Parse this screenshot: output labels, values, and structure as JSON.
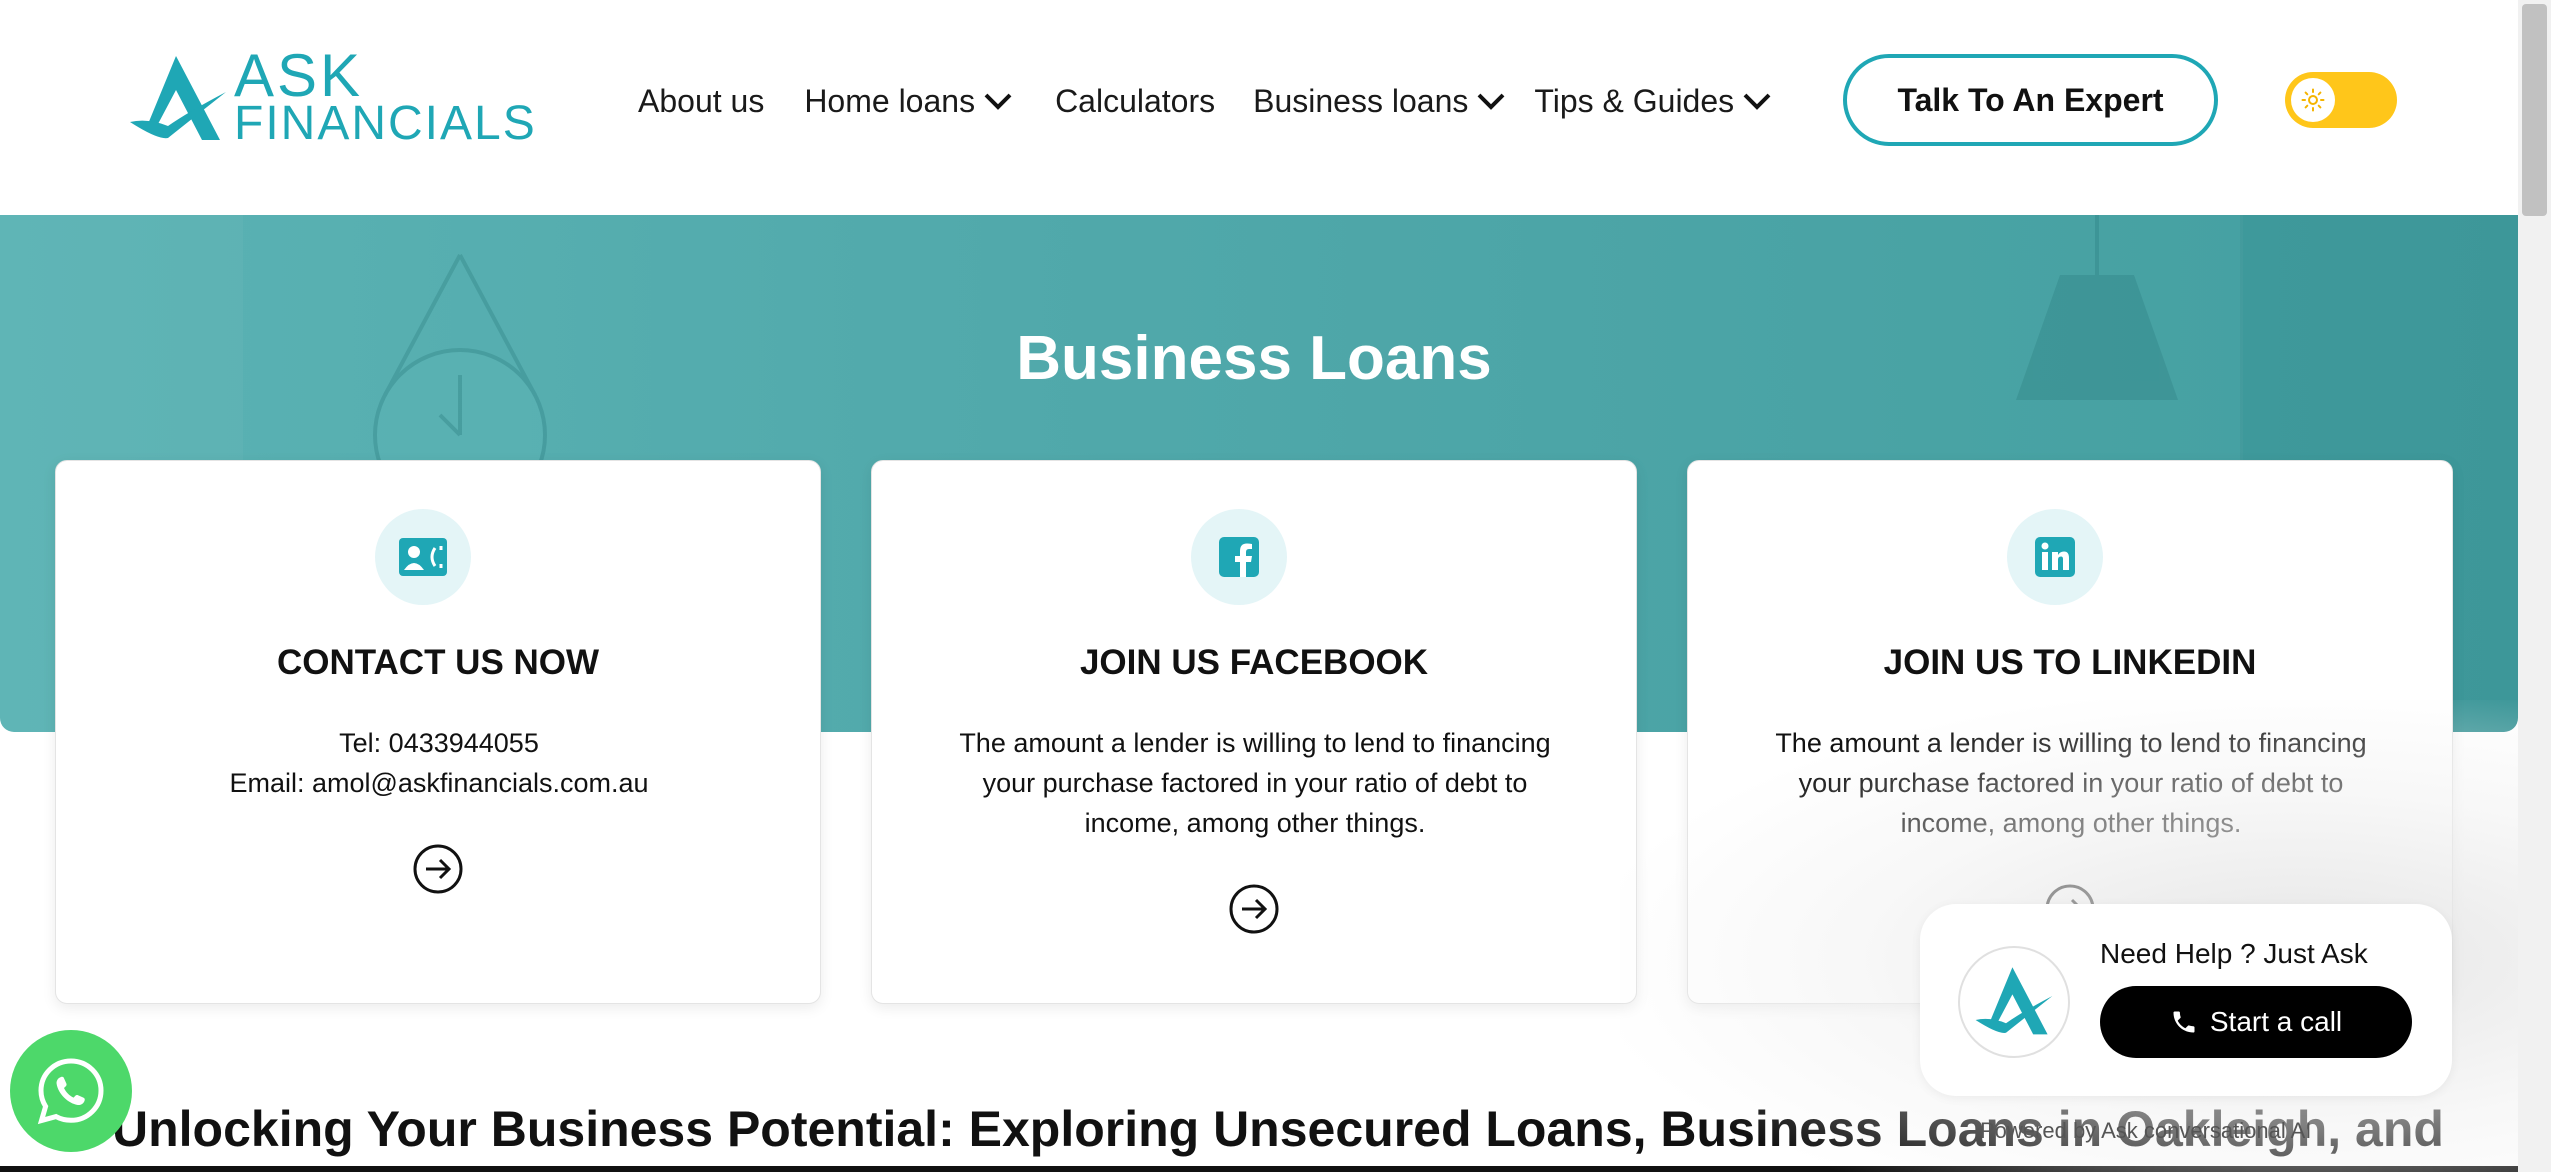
{
  "header": {
    "logo_line1": "ASK",
    "logo_line2": "FINANCIALS",
    "nav": [
      {
        "label": "About us",
        "has_dropdown": false
      },
      {
        "label": "Home loans",
        "has_dropdown": true
      },
      {
        "label": "Calculators",
        "has_dropdown": false
      },
      {
        "label": "Business loans",
        "has_dropdown": true
      },
      {
        "label": "Tips & Guides",
        "has_dropdown": true
      }
    ],
    "cta_label": "Talk To An Expert",
    "theme_toggle_icon": "sun-icon"
  },
  "hero": {
    "title": "Business Loans"
  },
  "cards": [
    {
      "icon": "contact-card-icon",
      "title": "CONTACT US NOW",
      "lines": [
        "Tel: 0433944055",
        "Email: amol@askfinancials.com.au"
      ]
    },
    {
      "icon": "facebook-icon",
      "title": "JOIN US FACEBOOK",
      "body": "The amount a lender is willing to lend to financing your purchase factored in your ratio of debt to income, among other things."
    },
    {
      "icon": "linkedin-icon",
      "title": "JOIN US TO LINKEDIN",
      "body": "The amount a lender is willing to lend to financing your purchase factored in your ratio of debt to income, among other things."
    }
  ],
  "chat": {
    "help_text": "Need Help ? Just Ask",
    "button_label": "Start a call",
    "powered_text": "Powered by Ask conversational AI"
  },
  "content": {
    "heading": "Unlocking Your Business Potential: Exploring Unsecured Loans, Business Loans in Oakleigh, and"
  },
  "colors": {
    "brand_teal": "#1fa7b5",
    "hero_teal": "#4ca7a9",
    "toggle_yellow": "#ffc61a",
    "whatsapp_green": "#4dd86a"
  }
}
